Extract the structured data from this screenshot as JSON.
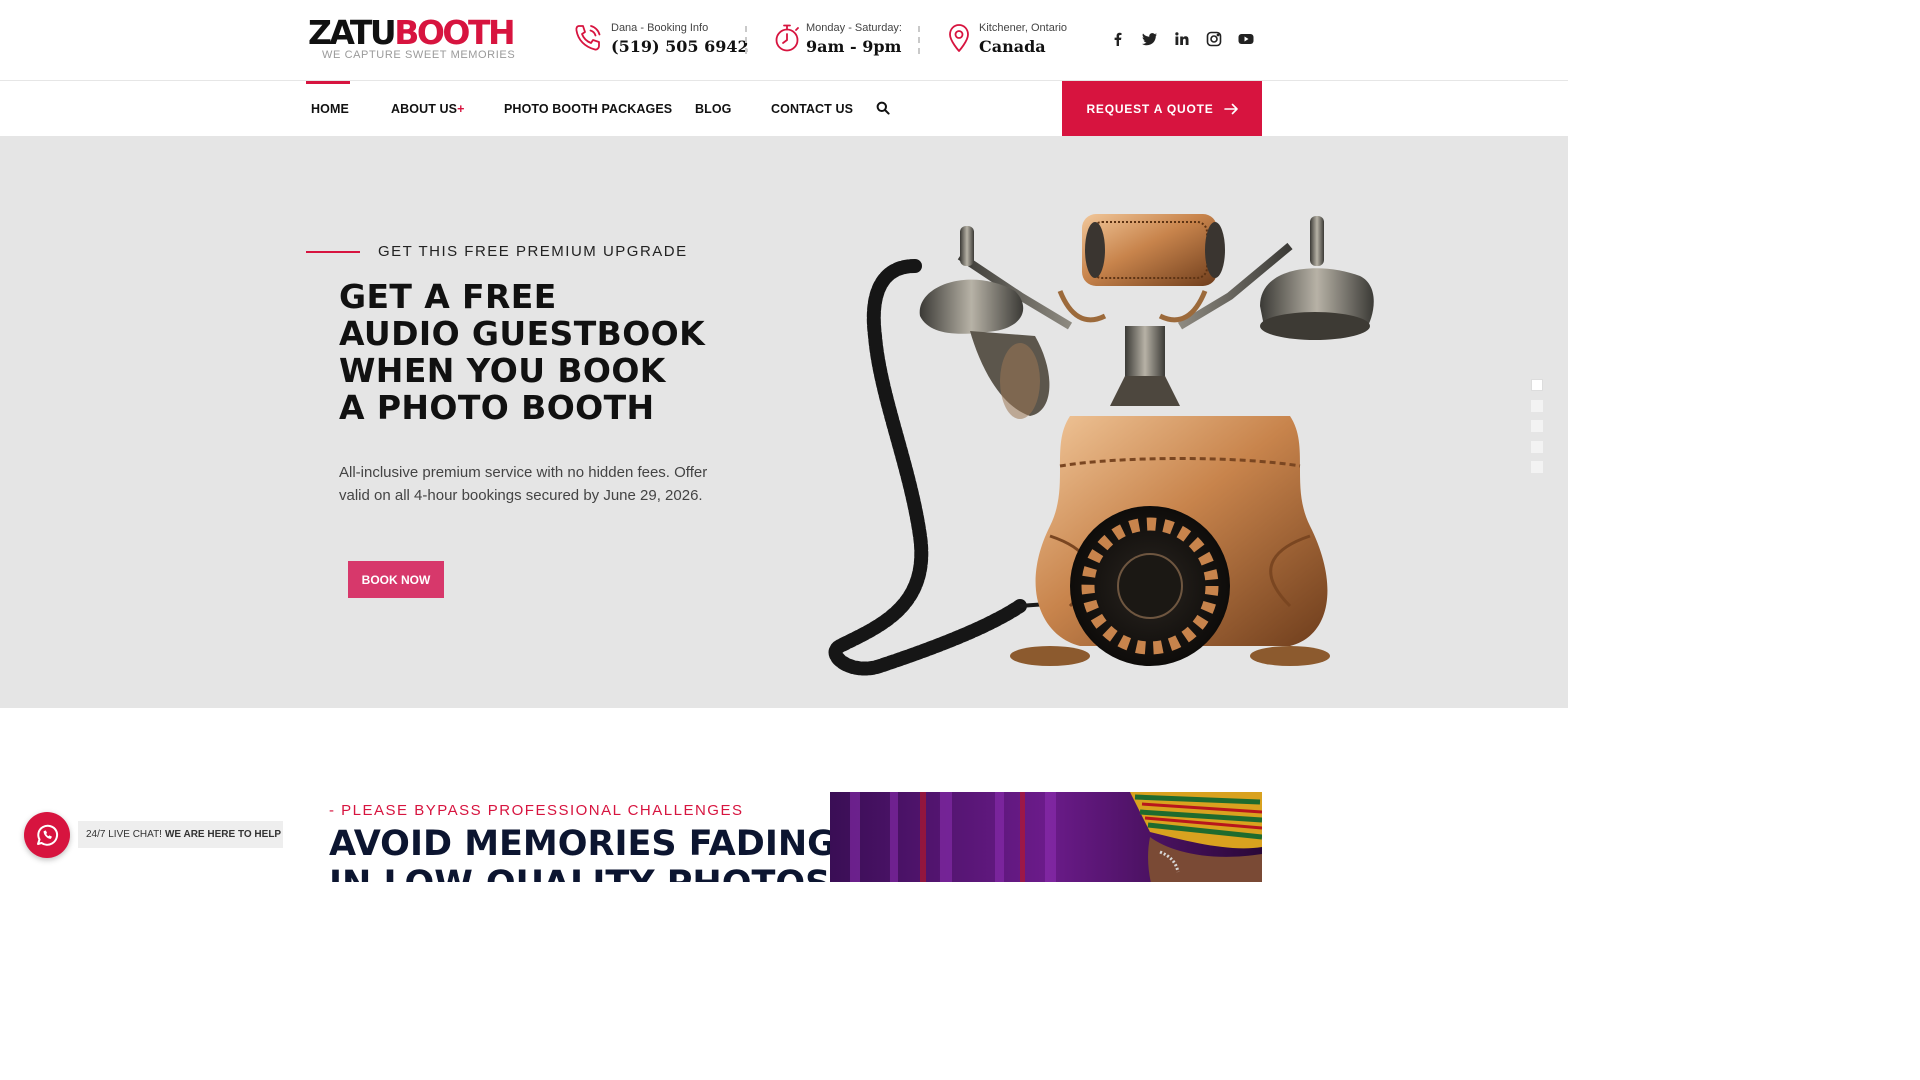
{
  "header": {
    "logo": {
      "word_dark": "ZATU",
      "word_red": "BOOTH",
      "tagline": "WE CAPTURE SWEET MEMORIES"
    },
    "contact": {
      "label": "Dana - Booking Info",
      "value": "(519) 505 6942",
      "icon": "phone-icon"
    },
    "hours": {
      "label": "Monday - Saturday:",
      "value": "9am - 9pm",
      "icon": "stopwatch-icon"
    },
    "location": {
      "label": "Kitchener, Ontario",
      "value": "Canada",
      "icon": "map-pin-icon"
    },
    "social": [
      "facebook-icon",
      "twitter-icon",
      "linkedin-icon",
      "instagram-icon",
      "youtube-icon"
    ]
  },
  "nav": {
    "items": [
      "HOME",
      "ABOUT US",
      "PHOTO BOOTH PACKAGES",
      "BLOG",
      "CONTACT US"
    ],
    "about_plus": "+",
    "active": "HOME",
    "quote_button": "REQUEST A QUOTE"
  },
  "hero": {
    "eyebrow": "GET THIS FREE PREMIUM UPGRADE",
    "title_lines": [
      "GET A FREE",
      "AUDIO GUESTBOOK",
      "WHEN YOU BOOK",
      "A PHOTO BOOTH"
    ],
    "description": "All-inclusive premium service with no hidden fees. Offer valid on all 4-hour bookings secured by June 29, 2026.",
    "button": "BOOK NOW",
    "slide_count": 5,
    "active_slide": 1
  },
  "section2": {
    "eyebrow": "- PLEASE BYPASS PROFESSIONAL CHALLENGES",
    "title_lines": [
      "AVOID MEMORIES FADING",
      "IN LOW-QUALITY PHOTOS"
    ]
  },
  "chat": {
    "prefix": "24/7 LIVE CHAT!",
    "emphasis": "WE ARE HERE TO HELP"
  },
  "colors": {
    "accent": "#d7143f",
    "book_button": "#d7386b",
    "hero_bg": "#e5e5e5",
    "heading_navy": "#0c1530"
  }
}
